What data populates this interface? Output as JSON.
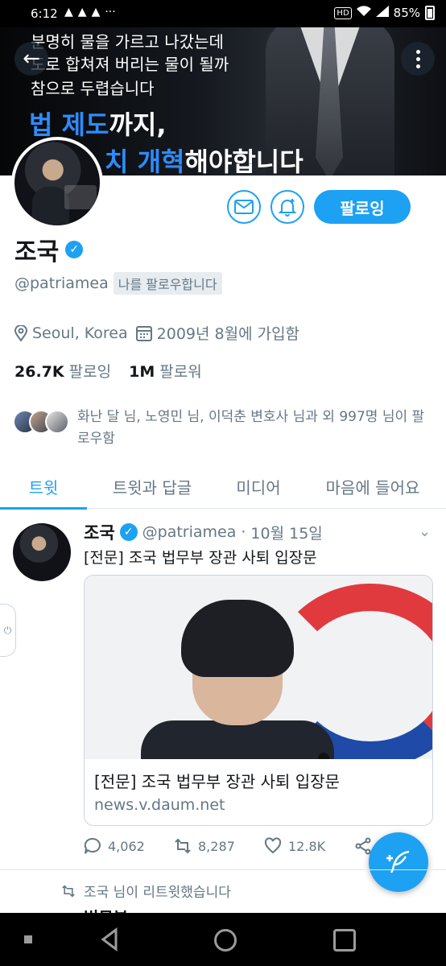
{
  "status_bar": {
    "time": "6:12",
    "network": "HD",
    "battery": "85%"
  },
  "banner": {
    "line1": "분명히 물을 가르고 나갔는데",
    "line2": "도로 합쳐져 버리는 물이 될까",
    "line3": "참으로 두렵습니다",
    "big1_blue": "법 제도",
    "big1_rest": "까지,",
    "big2_blue": "치 개혁",
    "big2_rest": "해야합니다"
  },
  "profile": {
    "name": "조국",
    "handle": "@patriamea",
    "follows_you": "나를 팔로우합니다",
    "location": "Seoul, Korea",
    "joined": "2009년 8월에 가입함",
    "following_count": "26.7K",
    "following_label": "팔로잉",
    "followers_count": "1M",
    "followers_label": "팔로워",
    "followed_by": "화난 달 님, 노영민 님, 이덕춘 변호사 님과 외 997명 님이 팔로우함",
    "follow_button": "팔로잉"
  },
  "tabs": [
    {
      "label": "트윗"
    },
    {
      "label": "트윗과 답글"
    },
    {
      "label": "미디어"
    },
    {
      "label": "마음에 들어요"
    }
  ],
  "tweet": {
    "name": "조국",
    "handle": "@patriamea",
    "dot": "·",
    "date": "10월 15일",
    "text": "[전문] 조국 법무부 장관 사퇴 입장문",
    "card_title": "[전문] 조국 법무부 장관 사퇴 입장문",
    "card_url": "news.v.daum.net",
    "replies": "4,062",
    "retweets": "8,287",
    "likes": "12.8K"
  },
  "retweet_notice": "조국 님이 리트윗했습니다",
  "next_tweet_peek": "법무부",
  "colors": {
    "accent": "#1da1f2",
    "text": "#14171a",
    "muted": "#657786"
  }
}
